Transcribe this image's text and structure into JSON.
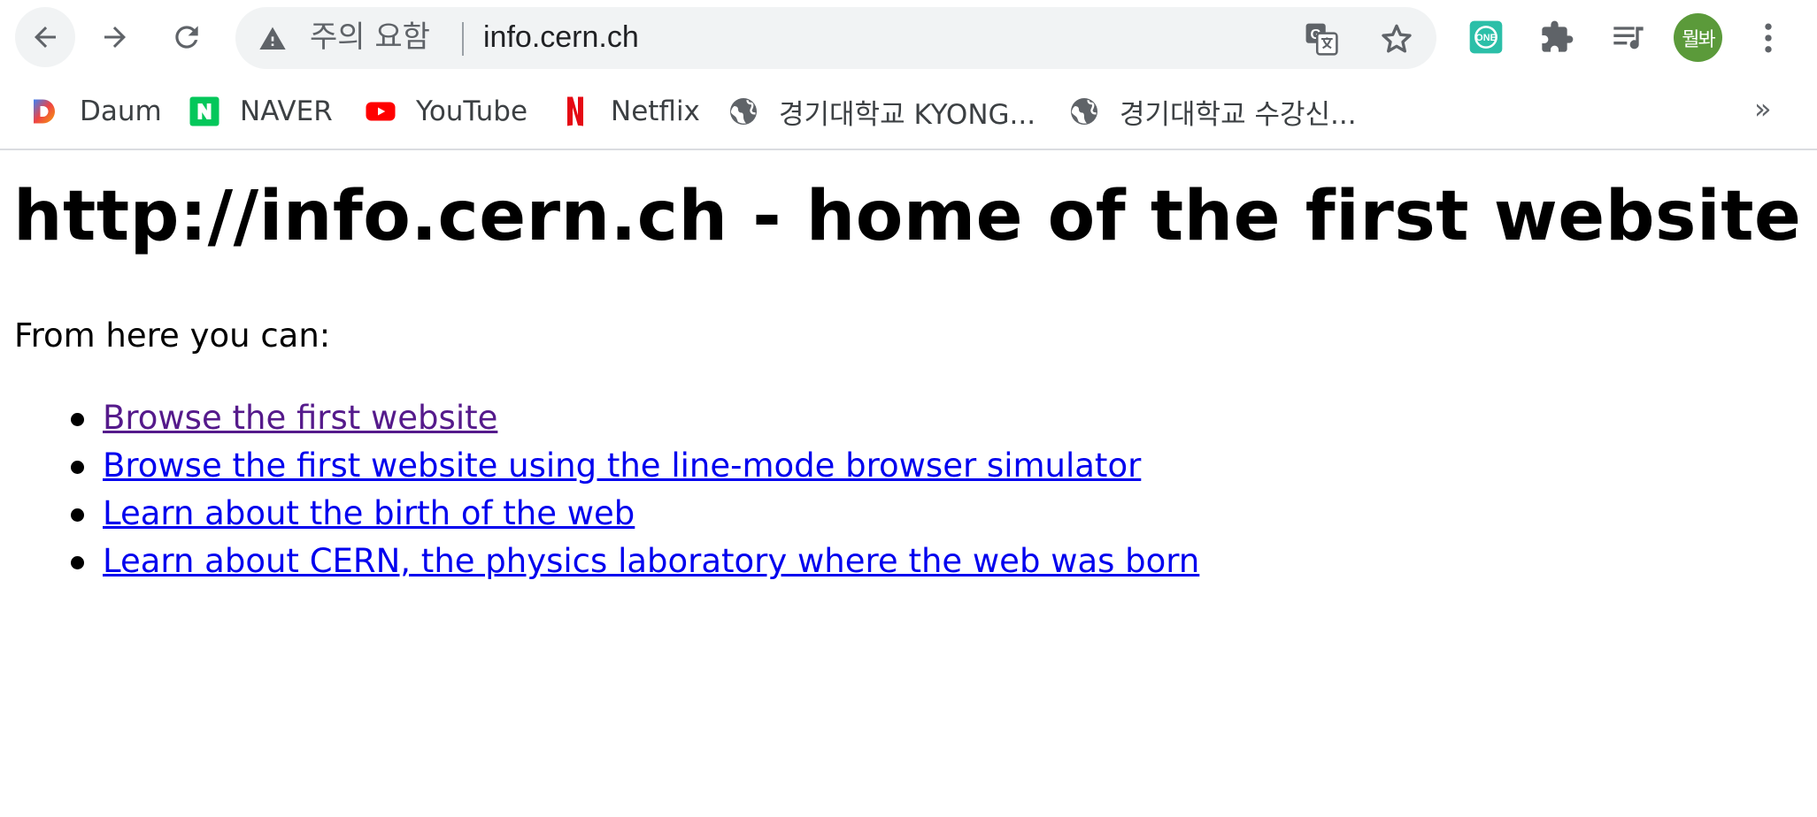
{
  "browser": {
    "nav": {
      "back_icon": "arrow-left-icon",
      "forward_icon": "arrow-right-icon",
      "reload_icon": "reload-icon"
    },
    "omnibox": {
      "security_label": "주의 요함",
      "url": "info.cern.ch",
      "warning_icon": "warning-triangle-icon",
      "translate_icon": "translate-icon",
      "bookmark_icon": "star-icon"
    },
    "extensions": [
      {
        "name": "one-extension-icon",
        "label": "ONE",
        "color": "#2cbfa8"
      },
      {
        "name": "puzzle-icon"
      },
      {
        "name": "media-control-icon"
      }
    ],
    "profile": {
      "label": "뭘봐",
      "color": "#5b9a3a"
    },
    "menu_icon": "kebab-menu-icon"
  },
  "bookmarks": {
    "items": [
      {
        "label": "Daum",
        "icon": "daum-icon"
      },
      {
        "label": "NAVER",
        "icon": "naver-icon",
        "color": "#03c75a"
      },
      {
        "label": "YouTube",
        "icon": "youtube-icon",
        "color": "#ff0000"
      },
      {
        "label": "Netflix",
        "icon": "netflix-icon",
        "color": "#e50914"
      },
      {
        "label": "경기대학교 KYONG...",
        "icon": "globe-icon"
      },
      {
        "label": "경기대학교 수강신...",
        "icon": "globe-icon"
      }
    ],
    "more": "»"
  },
  "page": {
    "title": "http://info.cern.ch - home of the first website",
    "intro": "From here you can:",
    "links": [
      {
        "label": "Browse the first website",
        "visited": true
      },
      {
        "label": "Browse the first website using the line-mode browser simulator",
        "visited": false
      },
      {
        "label": "Learn about the birth of the web",
        "visited": false
      },
      {
        "label": "Learn about CERN, the physics laboratory where the web was born",
        "visited": false
      }
    ],
    "link_color": "#0000ee",
    "visited_link_color": "#551a8b"
  }
}
